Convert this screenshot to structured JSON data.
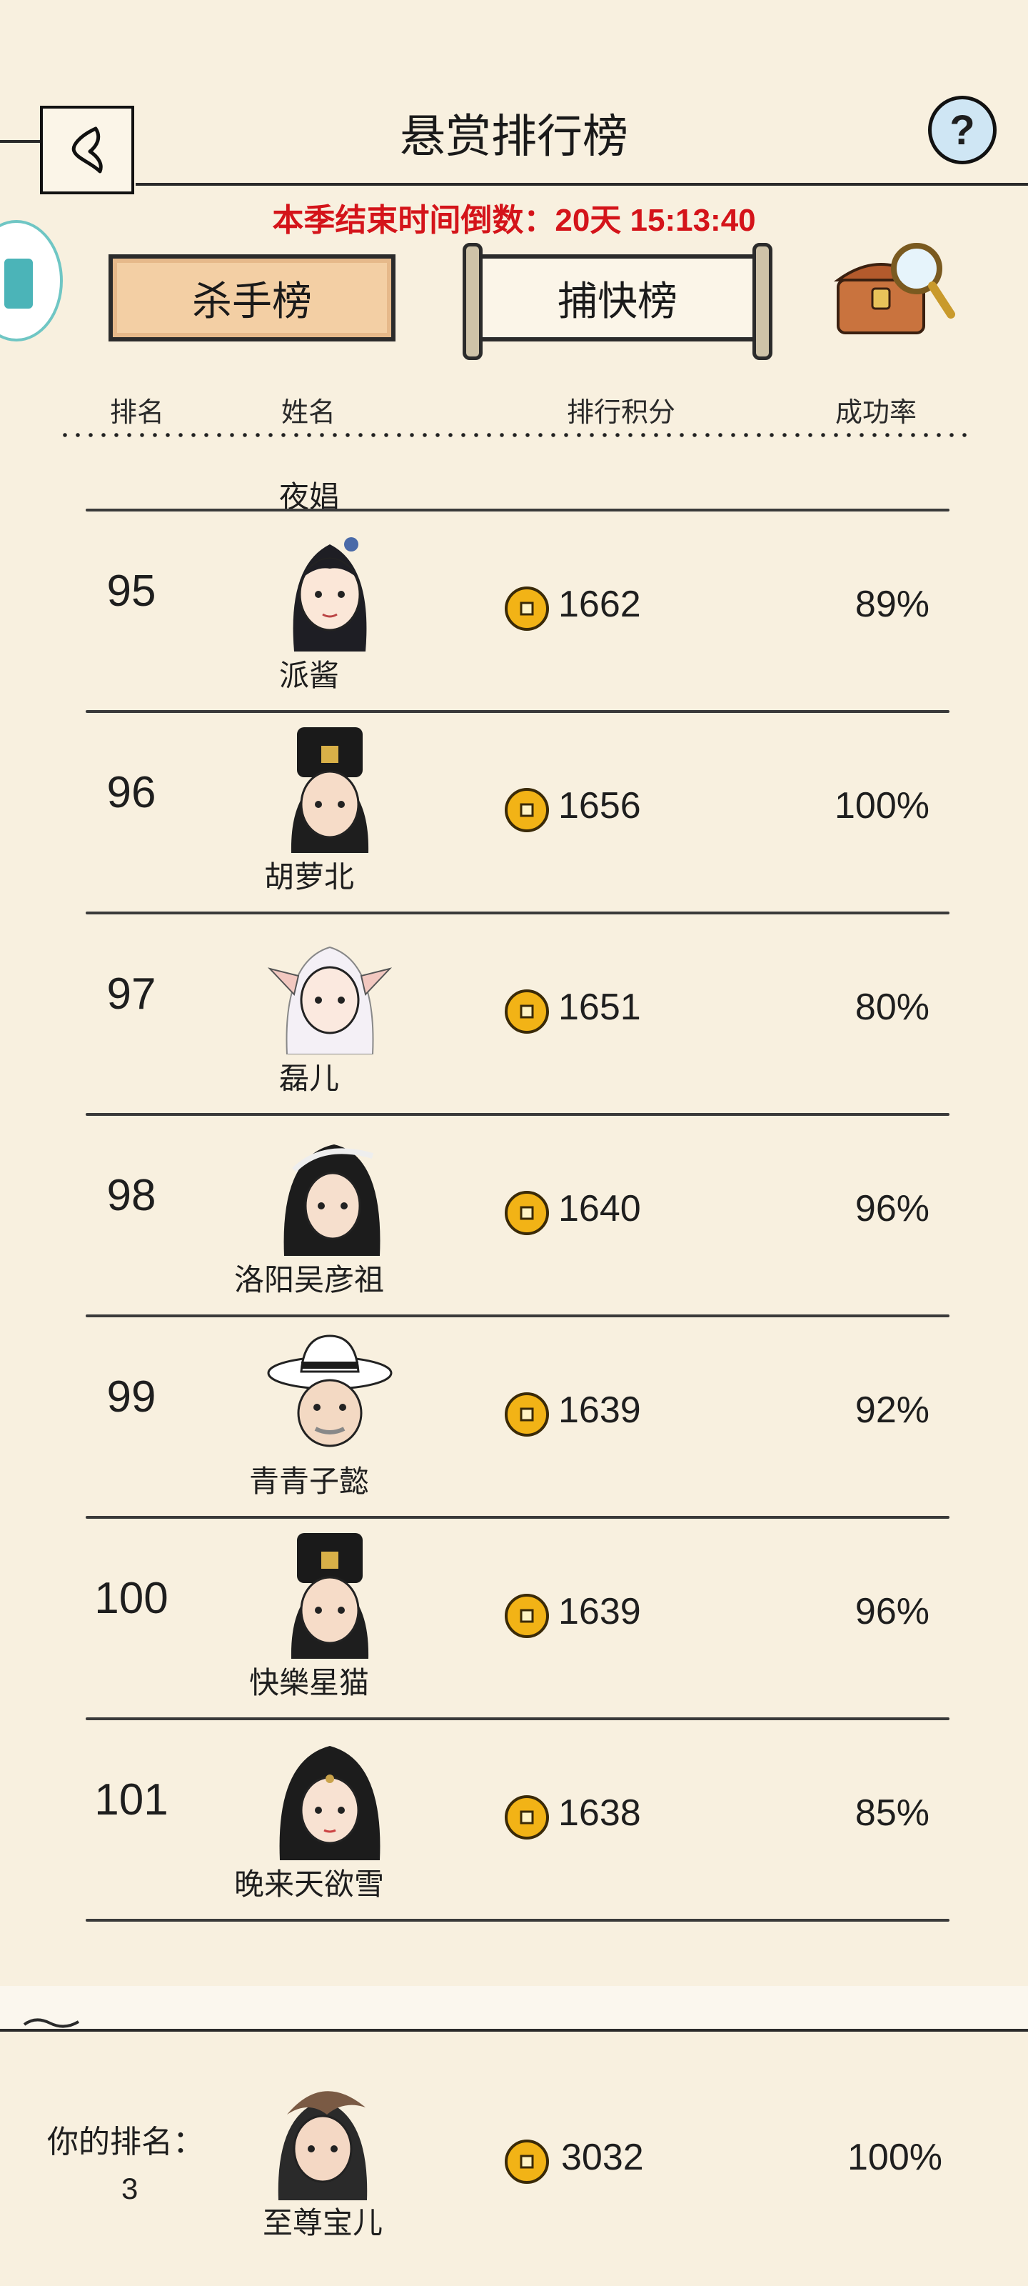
{
  "header": {
    "title": "悬赏排行榜",
    "countdown": "本季结束时间倒数：20天 15:13:40"
  },
  "tabs": [
    {
      "label": "杀手榜",
      "active": true
    },
    {
      "label": "捕快榜",
      "active": false
    }
  ],
  "columns": {
    "rank": "排名",
    "name": "姓名",
    "score": "排行积分",
    "rate": "成功率"
  },
  "partial_row": {
    "name": "夜娼"
  },
  "rows": [
    {
      "rank": "95",
      "name": "派酱",
      "score": "1662",
      "rate": "89%"
    },
    {
      "rank": "96",
      "name": "胡萝北",
      "score": "1656",
      "rate": "100%"
    },
    {
      "rank": "97",
      "name": "磊儿",
      "score": "1651",
      "rate": "80%"
    },
    {
      "rank": "98",
      "name": "洛阳吴彦祖",
      "score": "1640",
      "rate": "96%"
    },
    {
      "rank": "99",
      "name": "青青子懿",
      "score": "1639",
      "rate": "92%"
    },
    {
      "rank": "100",
      "name": "快樂星猫",
      "score": "1639",
      "rate": "96%"
    },
    {
      "rank": "101",
      "name": "晚来天欲雪",
      "score": "1638",
      "rate": "85%"
    }
  ],
  "my_rank": {
    "label": "你的排名：",
    "rank": "3",
    "name": "至尊宝儿",
    "score": "3032",
    "rate": "100%"
  },
  "colors": {
    "background": "#f8f0df",
    "countdown": "#d4141a",
    "tab_active": "#f3cfa4",
    "coin": "#f2b316"
  }
}
